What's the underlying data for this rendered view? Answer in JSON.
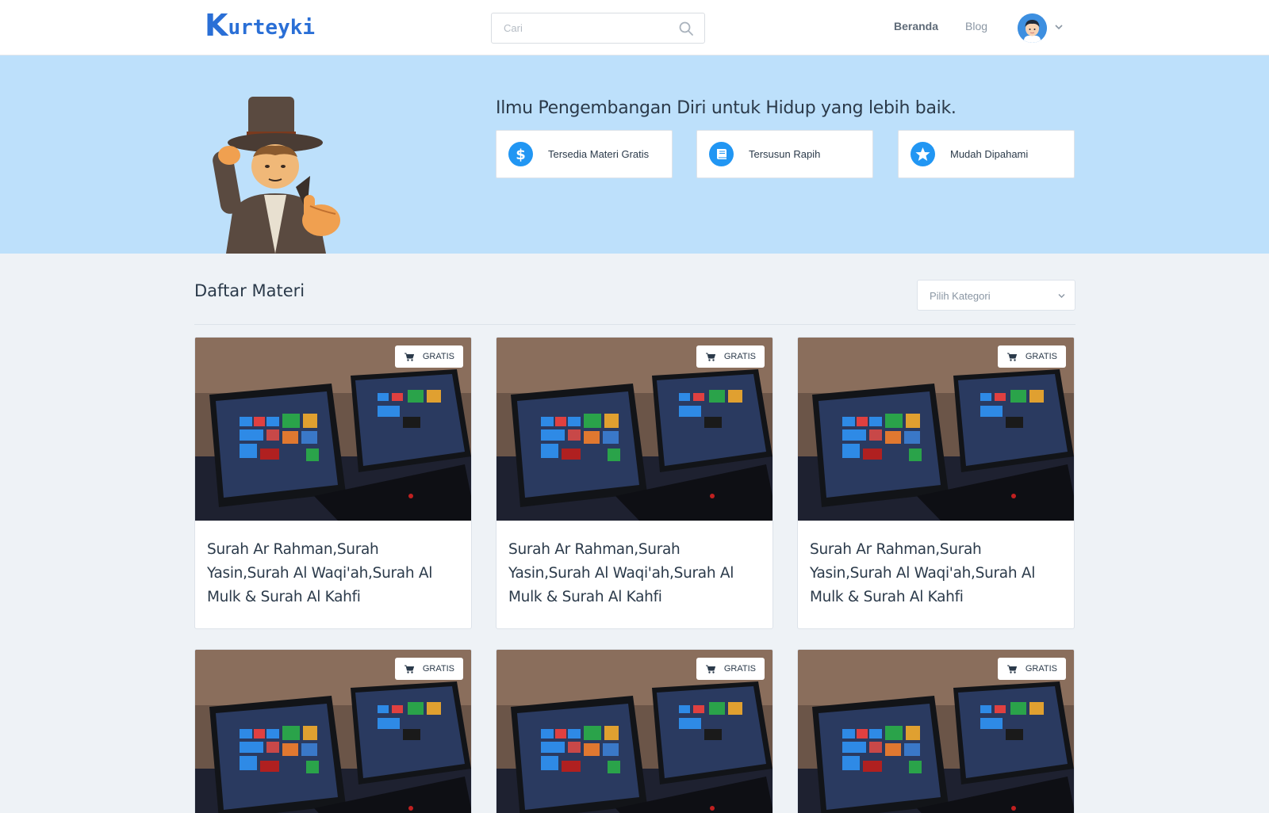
{
  "header": {
    "logo_k": "K",
    "logo_rest": "urteyki",
    "search": {
      "placeholder": "Cari"
    },
    "nav": [
      {
        "label": "Beranda"
      },
      {
        "label": "Blog"
      }
    ]
  },
  "hero": {
    "title": "Ilmu Pengembangan Diri untuk Hidup yang lebih baik.",
    "features": [
      {
        "label": "Tersedia Materi Gratis",
        "icon": "dollar-icon"
      },
      {
        "label": "Tersusun Rapih",
        "icon": "book-icon"
      },
      {
        "label": "Mudah Dipahami",
        "icon": "star-icon"
      }
    ]
  },
  "section": {
    "title": "Daftar Materi",
    "category_select": {
      "selected": "Pilih Kategori"
    }
  },
  "cards": [
    {
      "badge": "GRATIS",
      "title": "Surah Ar Rahman,Surah Yasin,Surah Al Waqi'ah,Surah Al Mulk & Surah Al Kahfi"
    },
    {
      "badge": "GRATIS",
      "title": "Surah Ar Rahman,Surah Yasin,Surah Al Waqi'ah,Surah Al Mulk & Surah Al Kahfi"
    },
    {
      "badge": "GRATIS",
      "title": "Surah Ar Rahman,Surah Yasin,Surah Al Waqi'ah,Surah Al Mulk & Surah Al Kahfi"
    },
    {
      "badge": "GRATIS",
      "title": ""
    },
    {
      "badge": "GRATIS",
      "title": ""
    },
    {
      "badge": "GRATIS",
      "title": ""
    }
  ],
  "colors": {
    "brand": "#2a6fd6",
    "hero_bg": "#bde0fb",
    "feature_icon": "#2196f3",
    "page_bg": "#eef2f6"
  }
}
